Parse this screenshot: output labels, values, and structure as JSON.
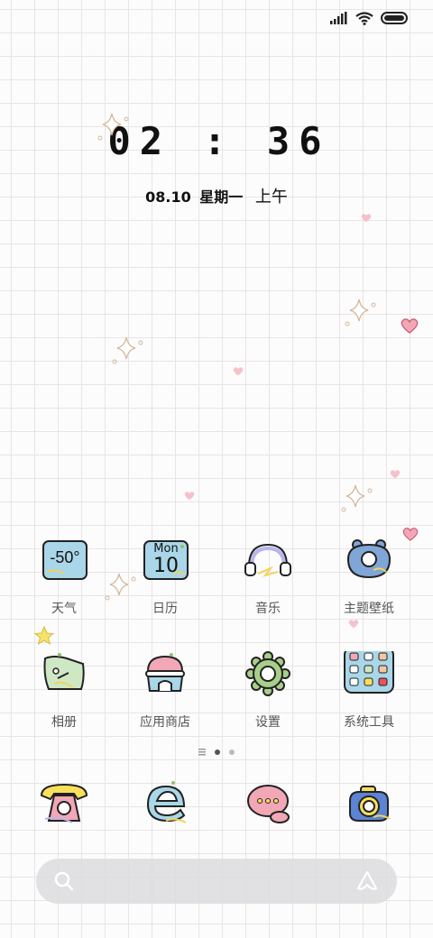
{
  "clock": {
    "time": "02 : 36"
  },
  "date": {
    "date": "08.10",
    "weekday": "星期一",
    "ampm": "上午"
  },
  "apps": [
    {
      "label": "天气",
      "icon": "weather-icon",
      "value": "-50°"
    },
    {
      "label": "日历",
      "icon": "calendar-icon",
      "day": "Mon",
      "date": "10"
    },
    {
      "label": "音乐",
      "icon": "headphones-icon"
    },
    {
      "label": "主题壁纸",
      "icon": "theme-icon"
    },
    {
      "label": "相册",
      "icon": "gallery-icon"
    },
    {
      "label": "应用商店",
      "icon": "app-store-icon"
    },
    {
      "label": "设置",
      "icon": "gear-icon"
    },
    {
      "label": "系统工具",
      "icon": "tools-folder-icon"
    }
  ],
  "dock": [
    {
      "icon": "phone-icon"
    },
    {
      "icon": "browser-icon"
    },
    {
      "icon": "messages-icon"
    },
    {
      "icon": "camera-icon"
    }
  ],
  "colors": {
    "pink": "#f4a5b0",
    "blue": "#a9d6e8",
    "yellow": "#f9e05a",
    "green": "#a8cf8a",
    "outline": "#222222"
  }
}
